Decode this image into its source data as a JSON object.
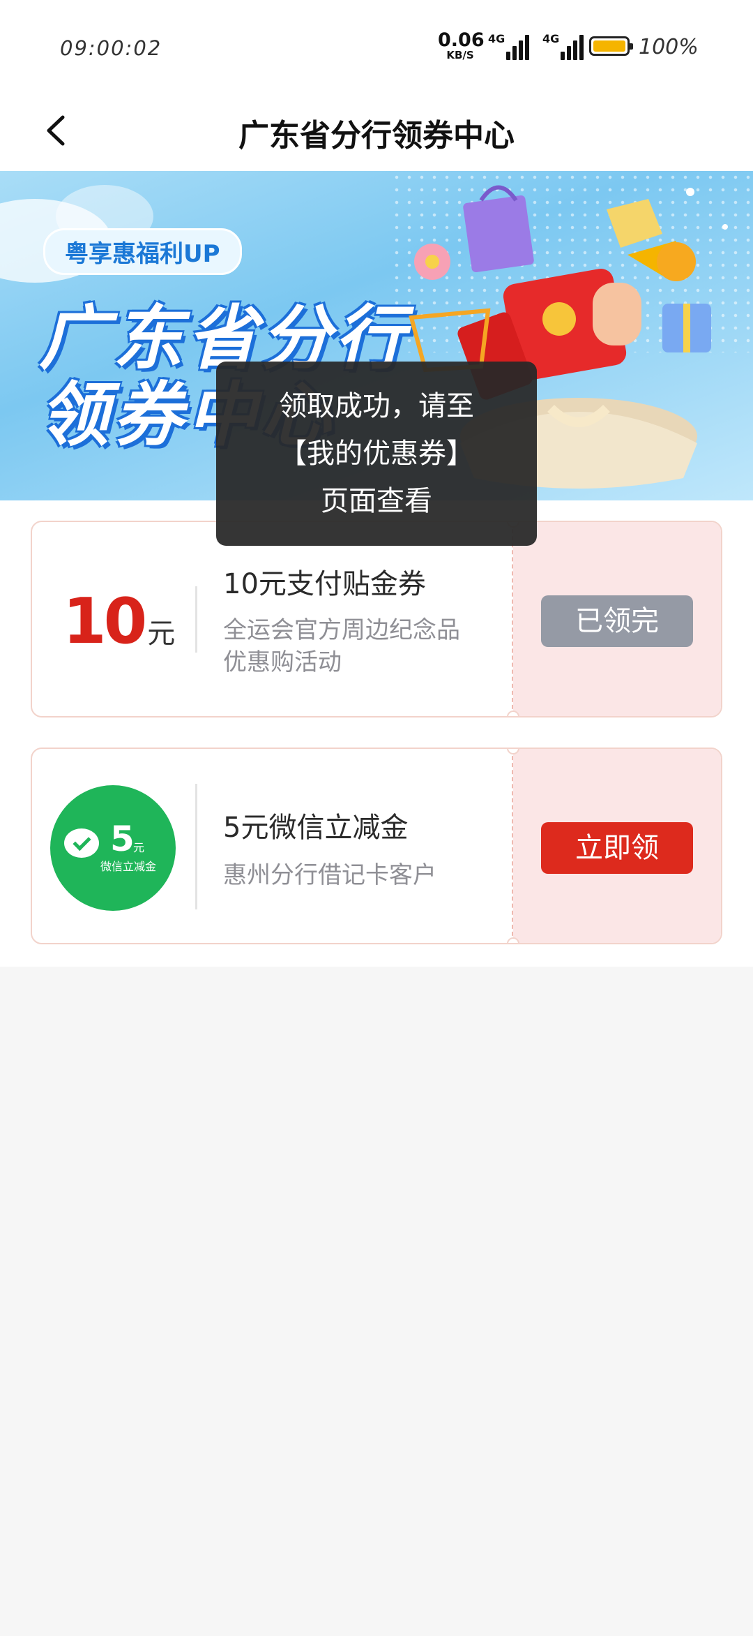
{
  "status_bar": {
    "time": "09:00:02",
    "net_speed_value": "0.06",
    "net_speed_unit": "KB/S",
    "sim1_tag": "4G",
    "sim2_tag": "4G",
    "battery_percent_text": "100%",
    "battery_level": 1.0
  },
  "nav": {
    "title": "广东省分行领券中心",
    "back_icon": "chevron-left-icon"
  },
  "banner": {
    "tag": "粤享惠福利UP",
    "headline_line1": "广东省分行",
    "headline_line2": "领券中心"
  },
  "coupons": [
    {
      "amount": "10",
      "unit": "元",
      "title": "10元支付贴金券",
      "desc_line1": "全运会官方周边纪念品",
      "desc_line2": "优惠购活动",
      "button": "已领完",
      "button_state": "disabled"
    },
    {
      "badge_amount": "5",
      "badge_unit": "元",
      "badge_label": "微信立减金",
      "badge_icon": "wechat-icon",
      "title": "5元微信立减金",
      "desc": "惠州分行借记卡客户",
      "button": "立即领",
      "button_state": "active"
    }
  ],
  "toast": {
    "line1": "领取成功，请至",
    "line2": "【我的优惠券】",
    "line3": "页面查看"
  },
  "colors": {
    "accent_red": "#dd2a1d",
    "amount_red": "#d8231a",
    "disabled_gray": "#959aa5",
    "coupon_right_bg": "#fbe6e6",
    "wechat_green": "#1fb559",
    "battery_yellow": "#f5b400"
  }
}
